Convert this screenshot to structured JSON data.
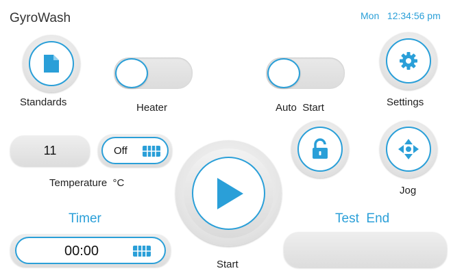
{
  "app": {
    "title": "GyroWash"
  },
  "clock": {
    "day": "Mon",
    "time": "12:34:56 pm"
  },
  "buttons": {
    "standards": "Standards",
    "settings": "Settings",
    "jog": "Jog",
    "start": "Start"
  },
  "toggles": {
    "heater": {
      "label": "Heater",
      "state": "off"
    },
    "auto_start": {
      "label": "Auto  Start",
      "state": "off"
    }
  },
  "temperature": {
    "value": "11",
    "unit_label": "Temperature  °C",
    "heater_state_label": "Off"
  },
  "timer": {
    "heading": "Timer",
    "value": "00:00"
  },
  "test_end": {
    "heading": "Test  End",
    "value": ""
  },
  "colors": {
    "accent": "#2a9fd8",
    "background": "#ffffff"
  },
  "icons": {
    "standards": "document-icon",
    "settings": "gear-icon",
    "jog": "move-arrows-icon",
    "lock": "unlock-icon",
    "start": "play-icon",
    "keypad": "keypad-icon"
  }
}
